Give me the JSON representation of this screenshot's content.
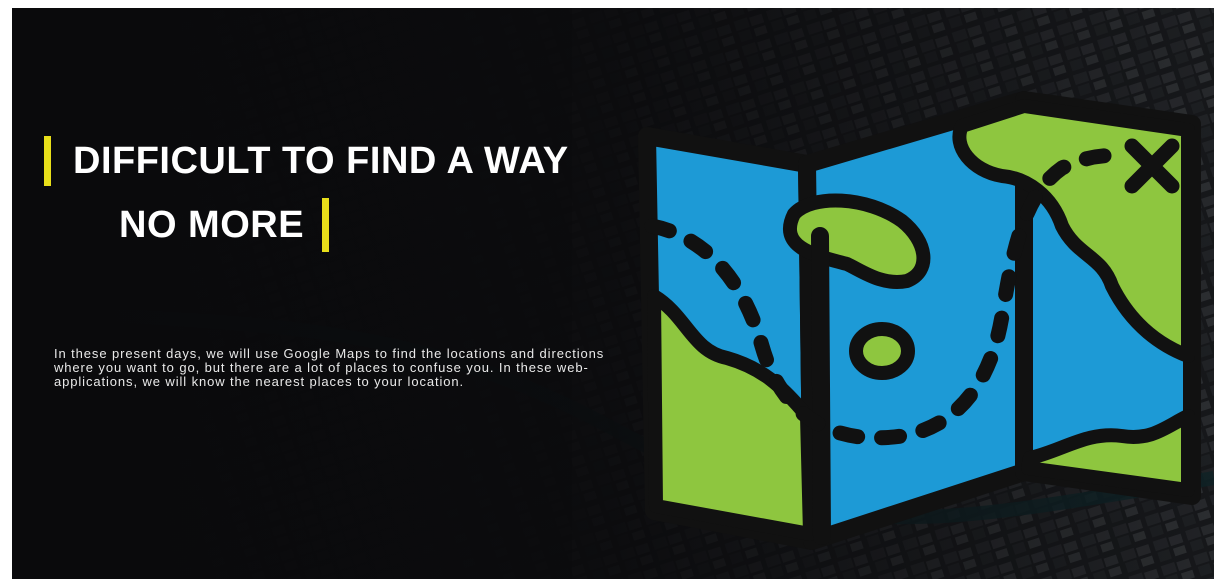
{
  "hero": {
    "title_line_1": "DIFFICULT TO FIND A WAY",
    "title_line_2": "NO MORE",
    "description": "In these present days, we will use Google Maps to find the locations and directions where you want to go, but there are a lot of places to confuse you. In these web-applications, we will know the nearest places to your location."
  },
  "colors": {
    "accent_bar": "#e8df1a",
    "map_blue": "#1d9ad6",
    "map_green": "#8ec63f",
    "outline": "#111111",
    "background": "#0b0b0d"
  },
  "icons": {
    "map": "folded-map-icon"
  }
}
